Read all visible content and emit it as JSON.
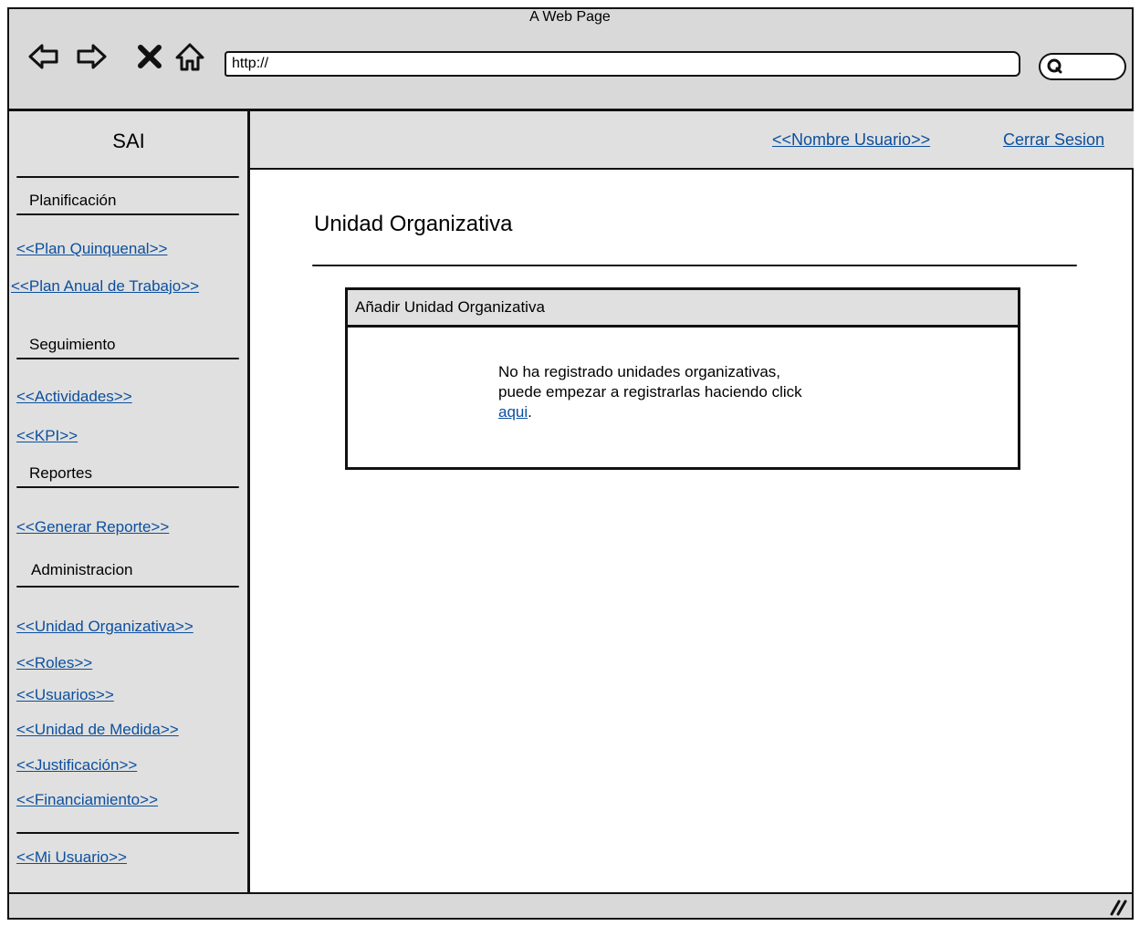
{
  "window": {
    "title": "A Web Page"
  },
  "browser": {
    "url": "http://"
  },
  "sidebar": {
    "app_title": "SAI",
    "sections": [
      {
        "title": "Planificación",
        "links": [
          "<<Plan Quinquenal>>",
          "<<Plan Anual de Trabajo>>"
        ]
      },
      {
        "title": "Seguimiento",
        "links": [
          "<<Actividades>>",
          "<<KPI>>"
        ]
      },
      {
        "title": "Reportes",
        "links": [
          "<<Generar Reporte>>"
        ]
      },
      {
        "title": "Administracion",
        "links": [
          "<<Unidad Organizativa>>",
          "<<Roles>>",
          "<<Usuarios>>",
          "<<Unidad de Medida>>",
          "<<Justificación>>",
          "<<Financiamiento>>"
        ]
      }
    ],
    "footer_link": "<<Mi Usuario>>"
  },
  "header": {
    "user_link": "<<Nombre Usuario>>",
    "logout_link": "Cerrar Sesion"
  },
  "main": {
    "title": "Unidad Organizativa",
    "panel": {
      "header": "Añadir Unidad Organizativa",
      "message_line1": "No ha registrado unidades organizativas,",
      "message_line2": "puede empezar a registrarlas haciendo click",
      "message_link": "aqui",
      "message_end": "."
    }
  },
  "colors": {
    "chrome": "#d9d9d9",
    "panel": "#e0e0e0",
    "link": "#0b4f9e"
  }
}
